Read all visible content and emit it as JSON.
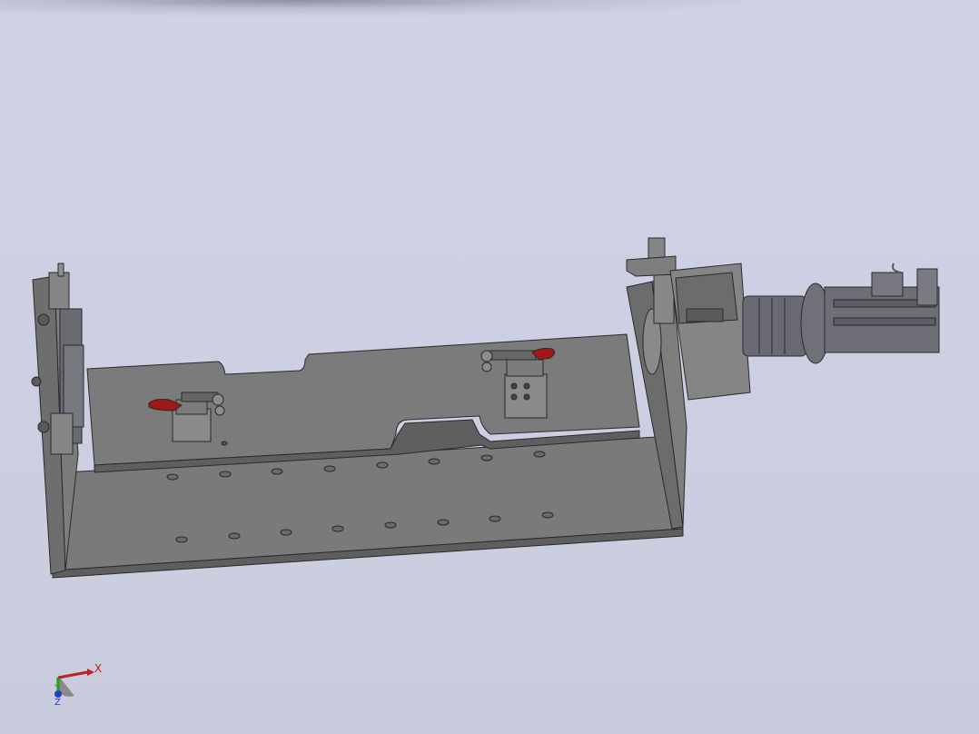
{
  "viewport": {
    "background_top": "#cfd1e6",
    "background_bottom": "#c9ccdc"
  },
  "model": {
    "base_color": "#7a7a7a",
    "base_dark": "#5e5e5e",
    "base_light": "#8c8c8c",
    "edge_color": "#2a2a2a",
    "clamp_handle_color": "#a01818",
    "motor_color": "#707078",
    "coupling_color": "#6a6a74",
    "parts": [
      {
        "name": "left-end-plate"
      },
      {
        "name": "base-plate"
      },
      {
        "name": "fixture-plate"
      },
      {
        "name": "right-end-plate"
      },
      {
        "name": "gearbox-housing"
      },
      {
        "name": "coupling"
      },
      {
        "name": "servo-motor"
      },
      {
        "name": "toggle-clamp-left"
      },
      {
        "name": "toggle-clamp-right"
      }
    ]
  },
  "triad": {
    "x_label": "X",
    "y_label": "Y",
    "z_label": "Z",
    "x_color": "#c02020",
    "y_color": "#20a020",
    "z_color": "#2040c0"
  }
}
